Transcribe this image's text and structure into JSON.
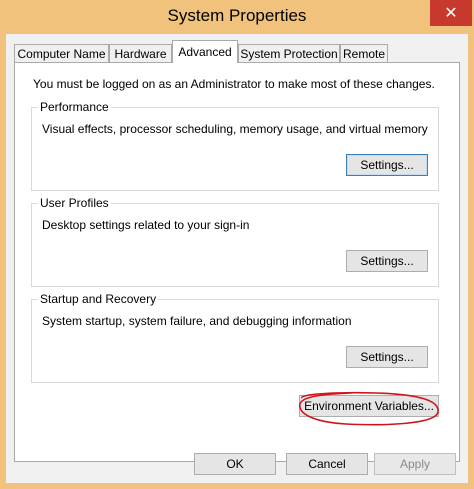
{
  "window": {
    "title": "System Properties",
    "close_label": "✕"
  },
  "tabs": [
    {
      "label": "Computer Name"
    },
    {
      "label": "Hardware"
    },
    {
      "label": "Advanced"
    },
    {
      "label": "System Protection"
    },
    {
      "label": "Remote"
    }
  ],
  "active_tab": "Advanced",
  "admin_note": "You must be logged on as an Administrator to make most of these changes.",
  "performance": {
    "title": "Performance",
    "description": "Visual effects, processor scheduling, memory usage, and virtual memory",
    "button": "Settings..."
  },
  "user_profiles": {
    "title": "User Profiles",
    "description": "Desktop settings related to your sign-in",
    "button": "Settings..."
  },
  "startup_recovery": {
    "title": "Startup and Recovery",
    "description": "System startup, system failure, and debugging information",
    "button": "Settings..."
  },
  "env_button": "Environment Variables...",
  "footer": {
    "ok": "OK",
    "cancel": "Cancel",
    "apply": "Apply"
  },
  "colors": {
    "titlebar": "#f0c27b",
    "close": "#c7392c",
    "annotation": "#d0141e"
  }
}
